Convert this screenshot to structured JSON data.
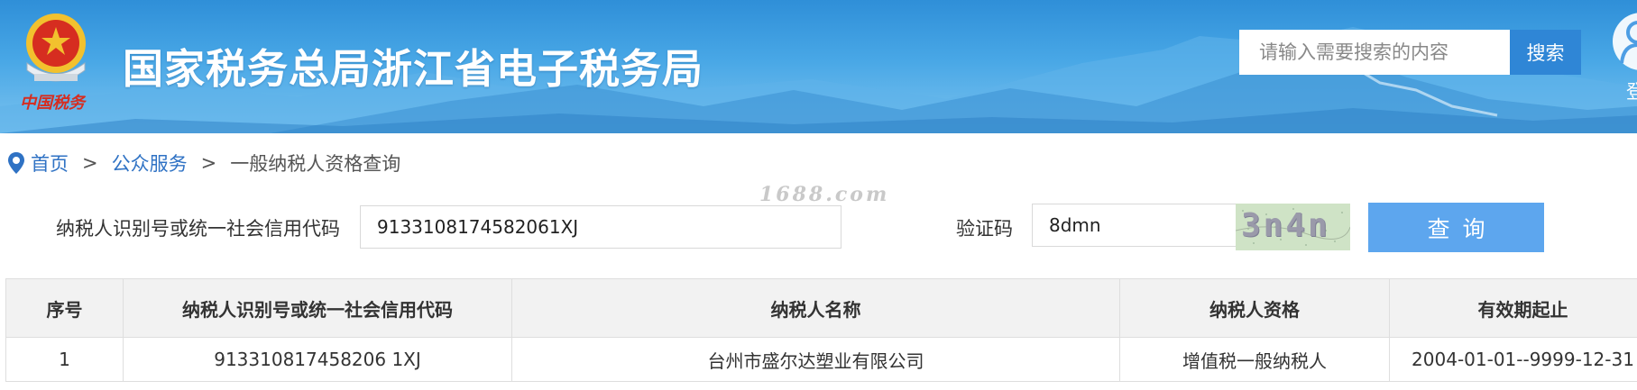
{
  "header": {
    "emblem_caption": "中国税务",
    "site_title": "国家税务总局浙江省电子税务局",
    "search_placeholder": "请输入需要搜索的内容",
    "search_button": "搜索",
    "login_label": "登"
  },
  "breadcrumb": {
    "home": "首页",
    "separator": ">",
    "section": "公众服务",
    "current": "一般纳税人资格查询"
  },
  "watermark": "1688.com",
  "form": {
    "taxpayer_id_label": "纳税人识别号或统一社会信用代码",
    "taxpayer_id_value": "9133108174582061XJ",
    "captcha_label": "验证码",
    "captcha_value": "8dmn",
    "captcha_image_text": "3n4n",
    "query_button": "查询"
  },
  "table": {
    "columns": [
      "序号",
      "纳税人识别号或统一社会信用代码",
      "纳税人名称",
      "纳税人资格",
      "有效期起止"
    ],
    "rows": [
      [
        "1",
        "913310817458206 1XJ",
        "台州市盛尔达塑业有限公司",
        "增值税一般纳税人",
        "2004-01-01--9999-12-31"
      ]
    ]
  },
  "colors": {
    "header_blue": "#2f8fd8",
    "search_button": "#2f86d6",
    "link_blue": "#2f72c4",
    "query_button": "#5da6ee",
    "emblem_red": "#d62d20",
    "emblem_gold": "#f2c12e"
  }
}
